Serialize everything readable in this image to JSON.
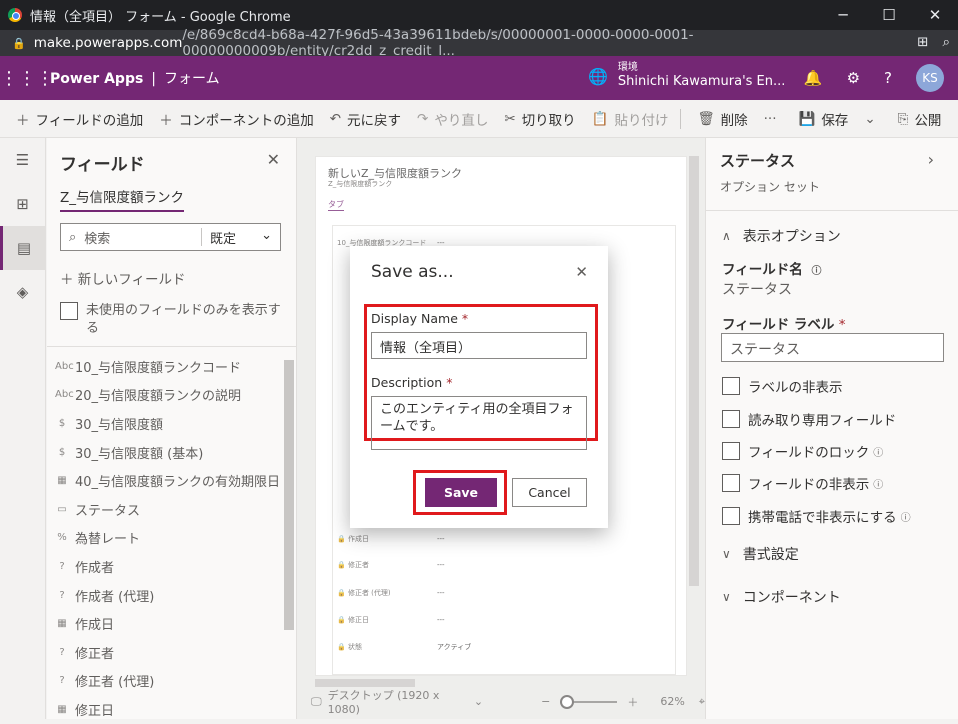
{
  "browser": {
    "title": "情報（全項目） フォーム - Google Chrome",
    "url_host": "make.powerapps.com",
    "url_path": "/e/869c8cd4-b68a-427f-96d5-43a39611bdeb/s/00000001-0000-0000-0001-00000000009b/entity/cr2dd_z_credit_l..."
  },
  "header": {
    "app_name": "Power Apps",
    "section": "フォーム",
    "env_label": "環境",
    "env_name": "Shinichi Kawamura's En...",
    "avatar_initials": "KS"
  },
  "commands": {
    "add_field": "フィールドの追加",
    "add_component": "コンポーネントの追加",
    "undo": "元に戻す",
    "redo": "やり直し",
    "cut": "切り取り",
    "paste": "貼り付け",
    "delete": "削除",
    "save": "保存",
    "publish": "公開"
  },
  "fields_panel": {
    "title": "フィールド",
    "entity_tab": "Z_与信限度額ランク",
    "search_placeholder": "検索",
    "filter_value": "既定",
    "new_field": "新しいフィールド",
    "unused_only": "未使用のフィールドのみを表示する",
    "items": [
      {
        "icon": "Abc",
        "label": "10_与信限度額ランクコード"
      },
      {
        "icon": "Abc",
        "label": "20_与信限度額ランクの説明"
      },
      {
        "icon": "$",
        "label": "30_与信限度額"
      },
      {
        "icon": "$",
        "label": "30_与信限度額 (基本)"
      },
      {
        "icon": "▦",
        "label": "40_与信限度額ランクの有効期限日"
      },
      {
        "icon": "▭",
        "label": "ステータス"
      },
      {
        "icon": "%",
        "label": "為替レート"
      },
      {
        "icon": "?",
        "label": "作成者"
      },
      {
        "icon": "?",
        "label": "作成者 (代理)"
      },
      {
        "icon": "▦",
        "label": "作成日"
      },
      {
        "icon": "?",
        "label": "修正者"
      },
      {
        "icon": "?",
        "label": "修正者 (代理)"
      },
      {
        "icon": "▦",
        "label": "修正日"
      }
    ]
  },
  "form_preview": {
    "title": "新しいZ_与信限度額ランク",
    "subtitle": "Z_与信限度額ランク",
    "tab": "タブ",
    "rows": [
      {
        "label": "10_与信限度額ランクコード",
        "value": "---"
      },
      {
        "label": "作成日",
        "value": "---"
      },
      {
        "label": "修正者",
        "value": "---"
      },
      {
        "label": "修正者 (代理)",
        "value": "---"
      },
      {
        "label": "修正日",
        "value": "---"
      },
      {
        "label": "状態",
        "value": "アクティブ"
      }
    ],
    "device": "デスクトップ (1920 x 1080)",
    "zoom": "62%"
  },
  "properties": {
    "title": "ステータス",
    "subtitle": "オプション セット",
    "display_options": "表示オプション",
    "field_name_label": "フィールド名",
    "field_name_value": "ステータス",
    "field_label_label": "フィールド ラベル",
    "field_label_value": "ステータス",
    "checkboxes": [
      "ラベルの非表示",
      "読み取り専用フィールド",
      "フィールドのロック",
      "フィールドの非表示",
      "携帯電話で非表示にする"
    ],
    "formatting": "書式設定",
    "components": "コンポーネント"
  },
  "dialog": {
    "title": "Save as...",
    "display_name_label": "Display Name",
    "display_name_value": "情報（全項目）",
    "description_label": "Description",
    "description_value": "このエンティティ用の全項目フォームです。",
    "required_mark": "*",
    "save": "Save",
    "cancel": "Cancel"
  }
}
